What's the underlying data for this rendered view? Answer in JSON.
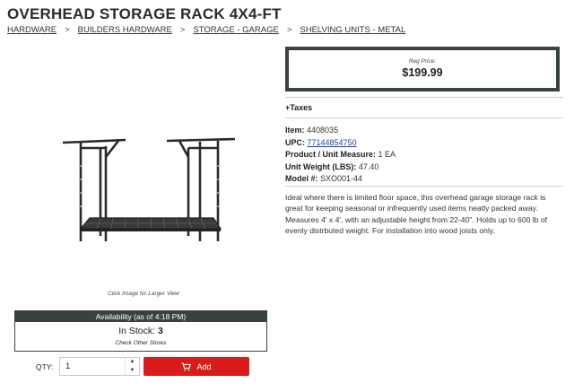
{
  "product": {
    "title": "OVERHEAD STORAGE RACK 4X4-FT",
    "breadcrumb": [
      "HARDWARE",
      "BUILDERS HARDWARE",
      "STORAGE - GARAGE",
      "SHELVING UNITS - METAL"
    ],
    "breadcrumb_separator": ">",
    "image_caption": "Click Image for Larger View",
    "price_label": "Reg Price:",
    "price": "$199.99",
    "taxes": "+Taxes",
    "item_label": "Item:",
    "item_value": "4408035",
    "upc_label": "UPC:",
    "upc_value": "77144854750",
    "measure_label": "Product / Unit Measure:",
    "measure_value": "1 EA",
    "weight_label": "Unit Weight (LBS):",
    "weight_value": "47.40",
    "model_label": "Model #:",
    "model_value": "SXO001-44",
    "description": "Ideal where there is limited floor space, this overhead garage storage rack is great for keeping seasonal or infrequently used items neatly packed away. Measures 4' x 4', with an adjustable height from 22-40\". Holds up to 600 lb of evenly distrbuted weight. For installation into wood joists only."
  },
  "availability": {
    "header": "Availability (as of 4:18 PM)",
    "stock_label": "In Stock:",
    "stock_count": "3",
    "check_stores": "Check Other Stores"
  },
  "cart": {
    "qty_label": "QTY:",
    "qty_value": "1",
    "add_label": "Add",
    "add_icon": "cart-icon",
    "accent_color": "#d81c1c"
  },
  "colors": {
    "frame": "#38433f",
    "link": "#1f3fa8"
  }
}
